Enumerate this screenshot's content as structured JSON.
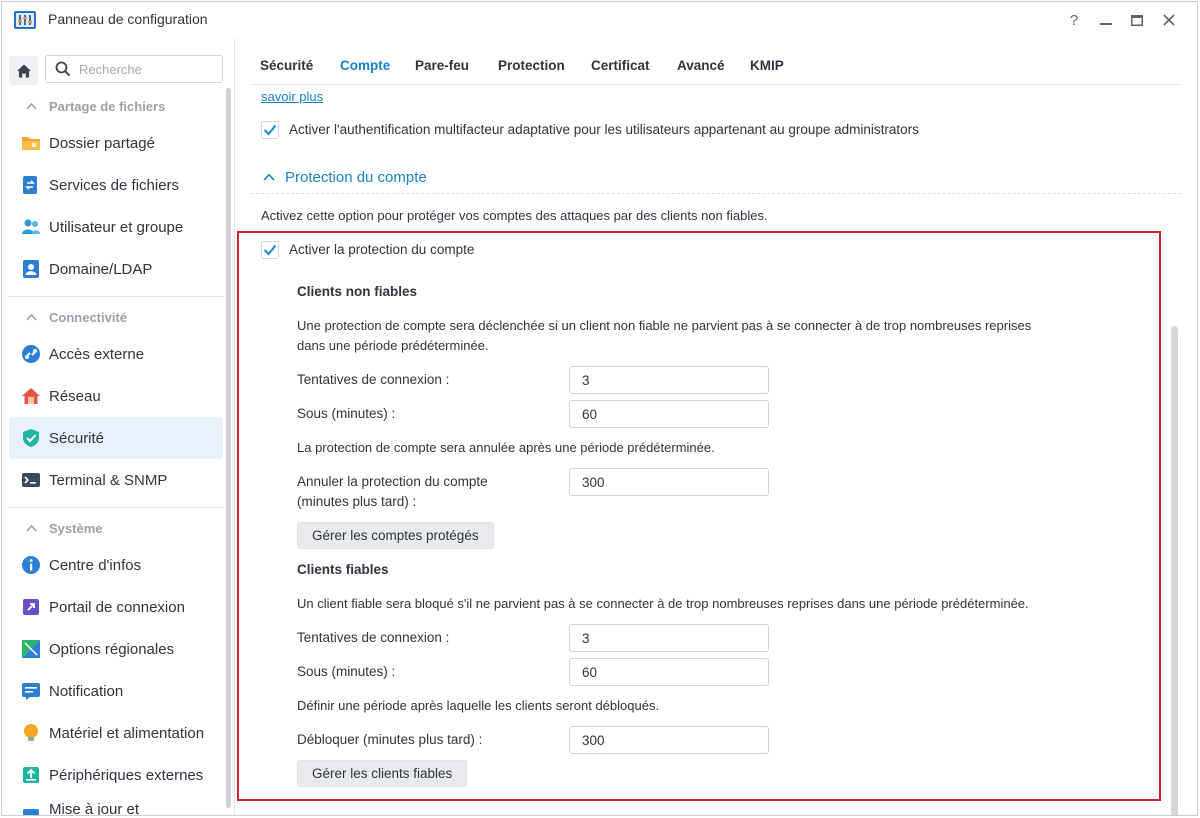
{
  "window": {
    "title": "Panneau de configuration",
    "controls": {
      "help": "?",
      "minimize": "–",
      "maximize": "☐",
      "close": "✕"
    }
  },
  "sidebar": {
    "search_placeholder": "Recherche",
    "sections": [
      {
        "label": "Partage de fichiers",
        "items": [
          "Dossier partagé",
          "Services de fichiers",
          "Utilisateur et groupe",
          "Domaine/LDAP"
        ]
      },
      {
        "label": "Connectivité",
        "items": [
          "Accès externe",
          "Réseau",
          "Sécurité",
          "Terminal & SNMP"
        ]
      },
      {
        "label": "Système",
        "items": [
          "Centre d'infos",
          "Portail de connexion",
          "Options régionales",
          "Notification",
          "Matériel et alimentation",
          "Périphériques externes",
          "Mise à jour et"
        ]
      }
    ],
    "active_item": "Sécurité"
  },
  "tabs": {
    "items": [
      "Sécurité",
      "Compte",
      "Pare-feu",
      "Protection",
      "Certificat",
      "Avancé",
      "KMIP"
    ],
    "active": "Compte"
  },
  "content": {
    "learn_more": "savoir plus",
    "adaptive_mfa_label": "Activer l'authentification multifacteur adaptative pour les utilisateurs appartenant au groupe administrators",
    "adaptive_mfa_checked": true,
    "section_title": "Protection du compte",
    "section_desc": "Activez cette option pour protéger vos comptes des attaques par des clients non fiables.",
    "enable_protection_label": "Activer la protection du compte",
    "enable_protection_checked": true,
    "untrusted": {
      "title": "Clients non fiables",
      "desc_line1": "Une protection de compte sera déclenchée si un client non fiable ne parvient pas à se connecter à de trop nombreuses reprises",
      "desc_line2": "dans une période prédéterminée.",
      "attempts_label": "Tentatives de connexion :",
      "attempts_value": "3",
      "within_label": "Sous (minutes) :",
      "within_value": "60",
      "cancel_note": "La protection de compte sera annulée après une période prédéterminée.",
      "cancel_label_line1": "Annuler la protection du compte",
      "cancel_label_line2": "(minutes plus tard) :",
      "cancel_value": "300",
      "manage_button": "Gérer les comptes protégés"
    },
    "trusted": {
      "title": "Clients fiables",
      "desc": "Un client fiable sera bloqué s'il ne parvient pas à se connecter à de trop nombreuses reprises dans une période prédéterminée.",
      "attempts_label": "Tentatives de connexion :",
      "attempts_value": "3",
      "within_label": "Sous (minutes) :",
      "within_value": "60",
      "unblock_note": "Définir une période après laquelle les clients seront débloqués.",
      "unblock_label": "Débloquer (minutes plus tard) :",
      "unblock_value": "300",
      "manage_button": "Gérer les clients fiables"
    }
  },
  "colors": {
    "accent": "#1a83c6",
    "highlight_box": "#d3232f",
    "sidebar_active_bg": "#e8f1fb"
  }
}
